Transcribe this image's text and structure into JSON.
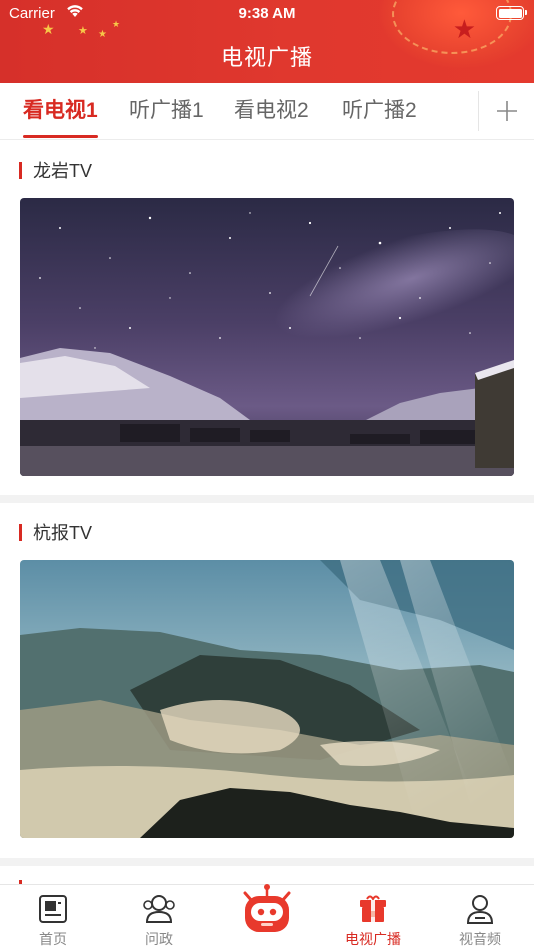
{
  "status_bar": {
    "carrier": "Carrier",
    "time": "9:38 AM"
  },
  "header": {
    "title": "电视广播"
  },
  "tabs": [
    {
      "label": "看电视1",
      "active": true
    },
    {
      "label": "听广播1",
      "active": false
    },
    {
      "label": "看电视2",
      "active": false
    },
    {
      "label": "听广播2",
      "active": false
    }
  ],
  "sections": [
    {
      "name": "龙岩TV",
      "image": "starry night sky over snowy mountain village"
    },
    {
      "name": "杭报TV",
      "image": "misty forested hills with sun rays"
    }
  ],
  "bottom_nav": [
    {
      "label": "首页",
      "icon": "newspaper-icon"
    },
    {
      "label": "问政",
      "icon": "people-icon"
    },
    {
      "label": "",
      "icon": "robot-icon"
    },
    {
      "label": "电视广播",
      "icon": "tv-gift-icon",
      "active": true
    },
    {
      "label": "视音频",
      "icon": "person-icon"
    }
  ],
  "colors": {
    "accent": "#d82a22",
    "header_bg": "#e0382e",
    "inactive_text": "#888888"
  }
}
